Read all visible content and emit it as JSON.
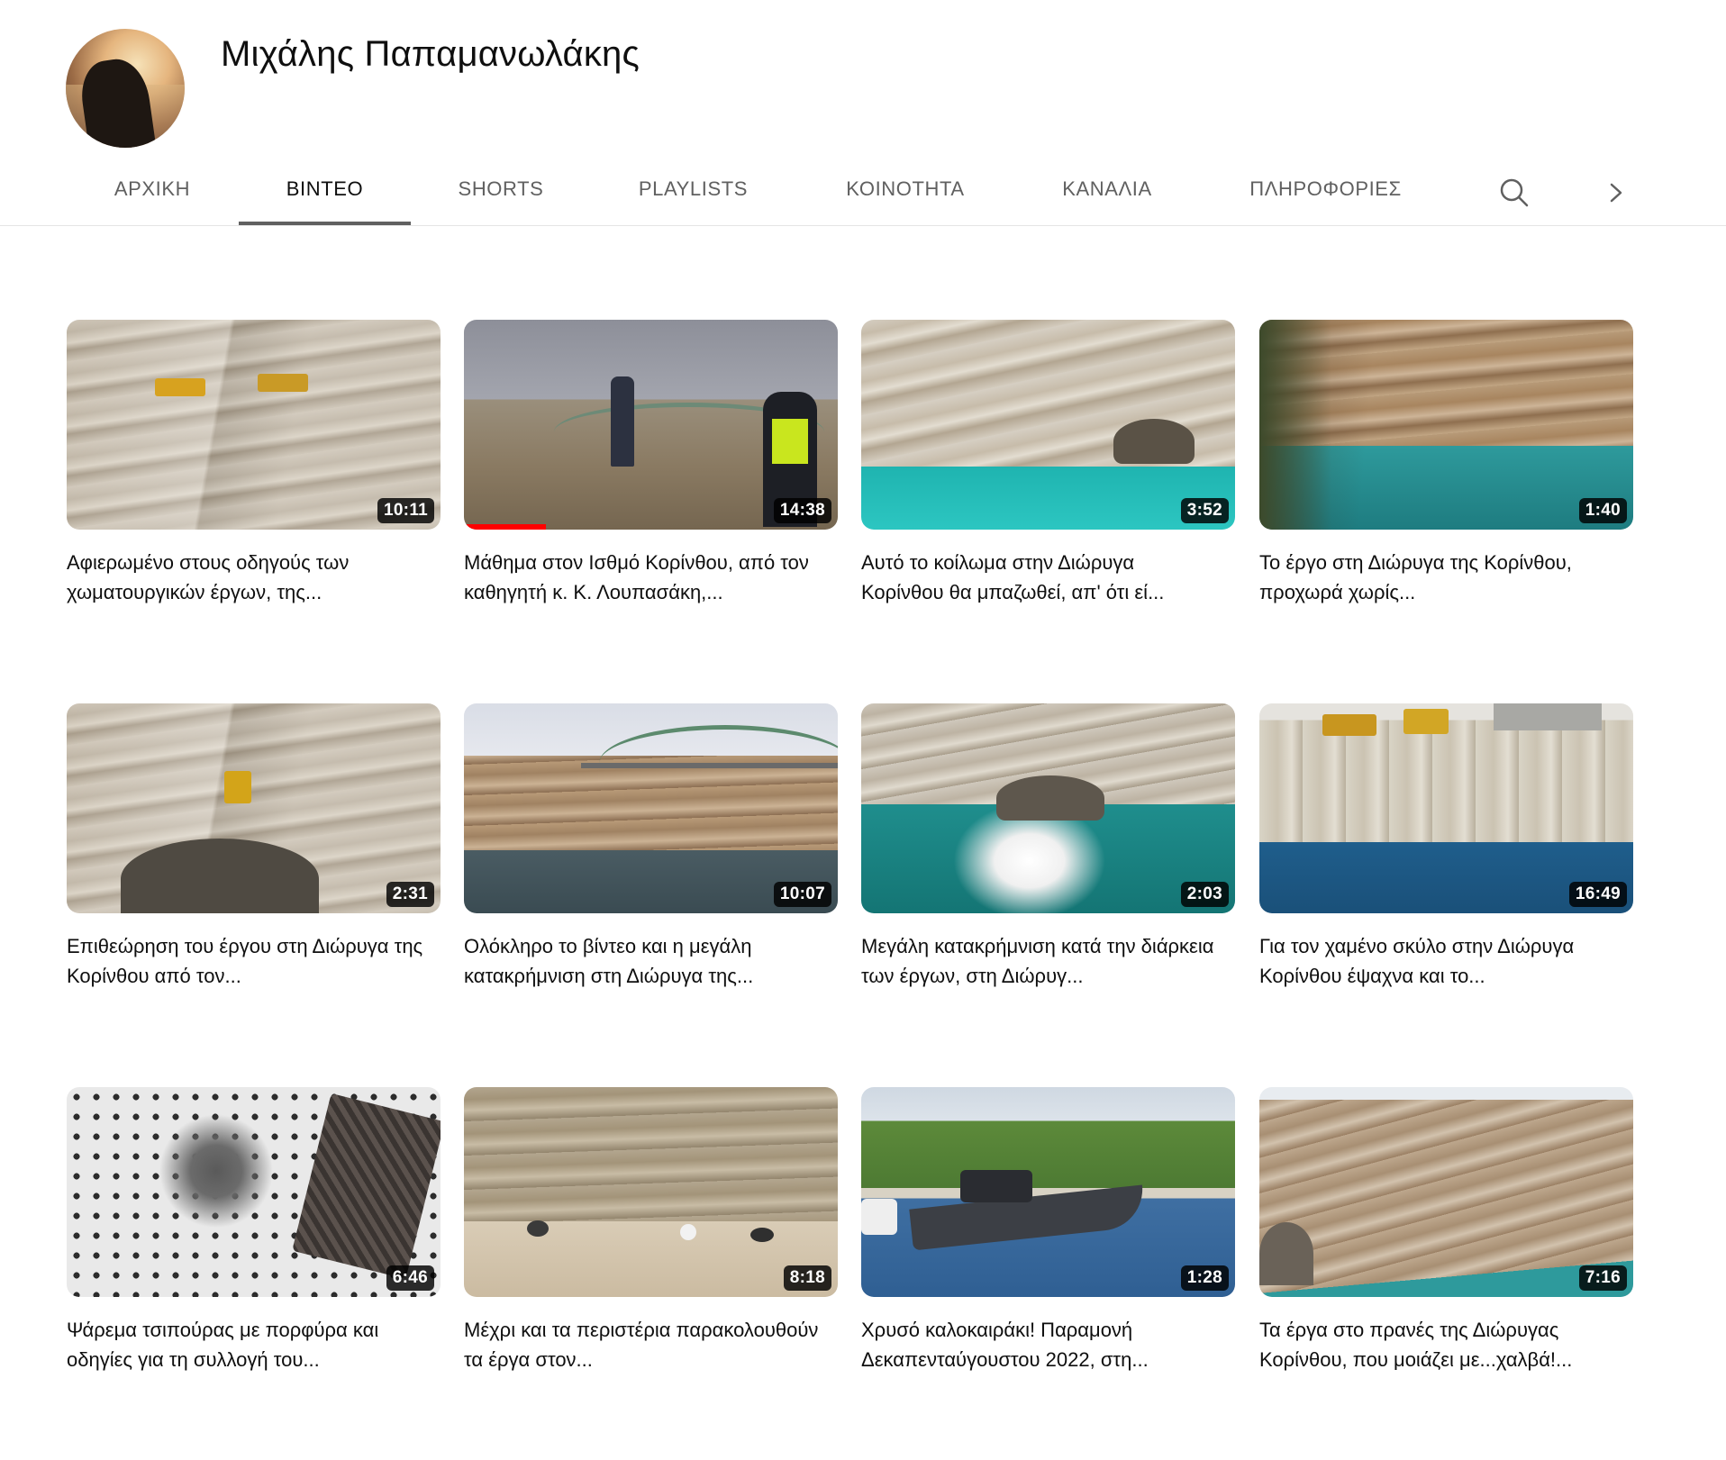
{
  "channel": {
    "name": "Μιχάλης Παπαμανωλάκης"
  },
  "tabs": [
    {
      "label": "ΑΡΧΙΚΗ",
      "active": false
    },
    {
      "label": "ΒΙΝΤΕΟ",
      "active": true
    },
    {
      "label": "SHORTS",
      "active": false
    },
    {
      "label": "PLAYLISTS",
      "active": false
    },
    {
      "label": "ΚΟΙΝΟΤΗΤΑ",
      "active": false
    },
    {
      "label": "ΚΑΝΑΛΙΑ",
      "active": false
    },
    {
      "label": "ΠΛΗΡΟΦΟΡΙΕΣ",
      "active": false
    }
  ],
  "tab_icons": {
    "search": "search-icon",
    "next": "chevron-right-icon"
  },
  "colors": {
    "progress": "#ff0000",
    "active_tab_underline": "#606060",
    "text_primary": "#0f0f0f",
    "text_secondary": "#606060"
  },
  "videos": [
    {
      "title": "Αφιερωμένο στους οδηγούς των χωματουργικών έργων, της...",
      "duration": "10:11",
      "thumb": "t-canyon"
    },
    {
      "title": "Μάθημα στον Ισθμό Κορίνθου, από τον καθηγητή κ. Κ. Λουπασάκη,...",
      "duration": "14:38",
      "thumb": "t-people",
      "watched_fraction": 0.22
    },
    {
      "title": "Αυτό το κοίλωμα στην Διώρυγα Κορίνθου θα μπαζωθεί, απ' ότι εί...",
      "duration": "3:52",
      "thumb": "t-canyon-blue"
    },
    {
      "title": "Το έργο στη Διώρυγα της Κορίνθου, προχωρά χωρίς...",
      "duration": "1:40",
      "thumb": "t-canyon-deep"
    },
    {
      "title": "Επιθεώρηση του έργου στη Διώρυγα της Κορίνθου από τον...",
      "duration": "2:31",
      "thumb": "t-canyon"
    },
    {
      "title": "Ολόκληρο το βίντεο και η μεγάλη κατακρήμνιση στη Διώρυγα της...",
      "duration": "10:07",
      "thumb": "t-bridge"
    },
    {
      "title": "Μεγάλη κατακρήμνιση κατά την διάρκεια των έργων, στη Διώρυγ...",
      "duration": "2:03",
      "thumb": "t-splash"
    },
    {
      "title": "Για τον χαμένο σκύλο στην Διώρυγα Κορίνθου έψαχνα και το...",
      "duration": "16:49",
      "thumb": "t-cliff-blue"
    },
    {
      "title": "Ψάρεμα τσιπούρας με πορφύρα και οδηγίες για τη συλλογή του...",
      "duration": "6:46",
      "thumb": "t-fish"
    },
    {
      "title": "Μέχρι και τα περιστέρια παρακολουθούν τα έργα στον...",
      "duration": "8:18",
      "thumb": "t-birds"
    },
    {
      "title": "Χρυσό καλοκαιράκι! Παραμονή Δεκαπενταύγουστου 2022, στη...",
      "duration": "1:28",
      "thumb": "t-boat"
    },
    {
      "title": "Τα έργα στο πρανές της Διώρυγας Κορίνθου, που μοιάζει με...χαλβά!...",
      "duration": "7:16",
      "thumb": "t-slope"
    }
  ]
}
